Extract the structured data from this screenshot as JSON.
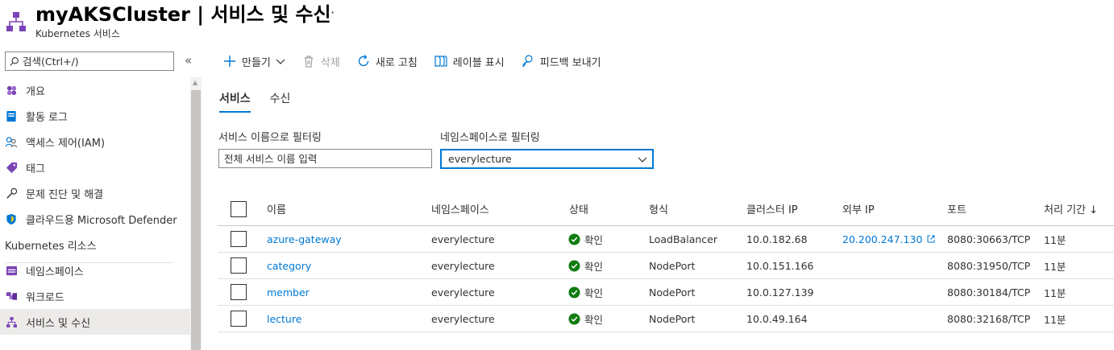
{
  "header": {
    "title": "myAKSCluster | 서비스 및 수신",
    "subtitle": "Kubernetes 서비스",
    "more": "···"
  },
  "sidebar": {
    "search_placeholder": "검색(Ctrl+/)",
    "collapse": "«",
    "items": [
      {
        "label": "개요",
        "icon": "overview-icon"
      },
      {
        "label": "활동 로그",
        "icon": "activity-log-icon"
      },
      {
        "label": "액세스 제어(IAM)",
        "icon": "iam-icon"
      },
      {
        "label": "태그",
        "icon": "tag-icon"
      },
      {
        "label": "문제 진단 및 해결",
        "icon": "wrench-icon"
      },
      {
        "label": "클라우드용 Microsoft Defender",
        "icon": "shield-icon"
      }
    ],
    "section_title": "Kubernetes 리소스",
    "k8s_items": [
      {
        "label": "네임스페이스",
        "icon": "namespace-icon"
      },
      {
        "label": "워크로드",
        "icon": "workload-icon"
      },
      {
        "label": "서비스 및 수신",
        "icon": "services-icon",
        "selected": true
      }
    ]
  },
  "toolbar": {
    "create": "만들기",
    "delete": "삭제",
    "refresh": "새로 고침",
    "show_labels": "레이블 표시",
    "feedback": "피드백 보내기"
  },
  "tabs": [
    {
      "label": "서비스",
      "active": true
    },
    {
      "label": "수신",
      "active": false
    }
  ],
  "filters": {
    "service_label": "서비스 이름으로 필터링",
    "service_placeholder": "전체 서비스 이름 입력",
    "namespace_label": "네임스페이스로 필터링",
    "namespace_value": "everylecture"
  },
  "table": {
    "columns": [
      "이름",
      "네임스페이스",
      "상태",
      "형식",
      "클러스터 IP",
      "외부 IP",
      "포트",
      "처리 기간 ↓"
    ],
    "rows": [
      {
        "name": "azure-gateway",
        "namespace": "everylecture",
        "status": "확인",
        "type": "LoadBalancer",
        "cluster_ip": "10.0.182.68",
        "external_ip": "20.200.247.130",
        "ports": "8080:30663/TCP",
        "age": "11분"
      },
      {
        "name": "category",
        "namespace": "everylecture",
        "status": "확인",
        "type": "NodePort",
        "cluster_ip": "10.0.151.166",
        "external_ip": "",
        "ports": "8080:31950/TCP",
        "age": "11분"
      },
      {
        "name": "member",
        "namespace": "everylecture",
        "status": "확인",
        "type": "NodePort",
        "cluster_ip": "10.0.127.139",
        "external_ip": "",
        "ports": "8080:30184/TCP",
        "age": "11분"
      },
      {
        "name": "lecture",
        "namespace": "everylecture",
        "status": "확인",
        "type": "NodePort",
        "cluster_ip": "10.0.49.164",
        "external_ip": "",
        "ports": "8080:32168/TCP",
        "age": "11분"
      }
    ]
  },
  "colors": {
    "accent": "#0078d4",
    "status_ok": "#107c10",
    "resource_icon": "#7a43b6"
  }
}
